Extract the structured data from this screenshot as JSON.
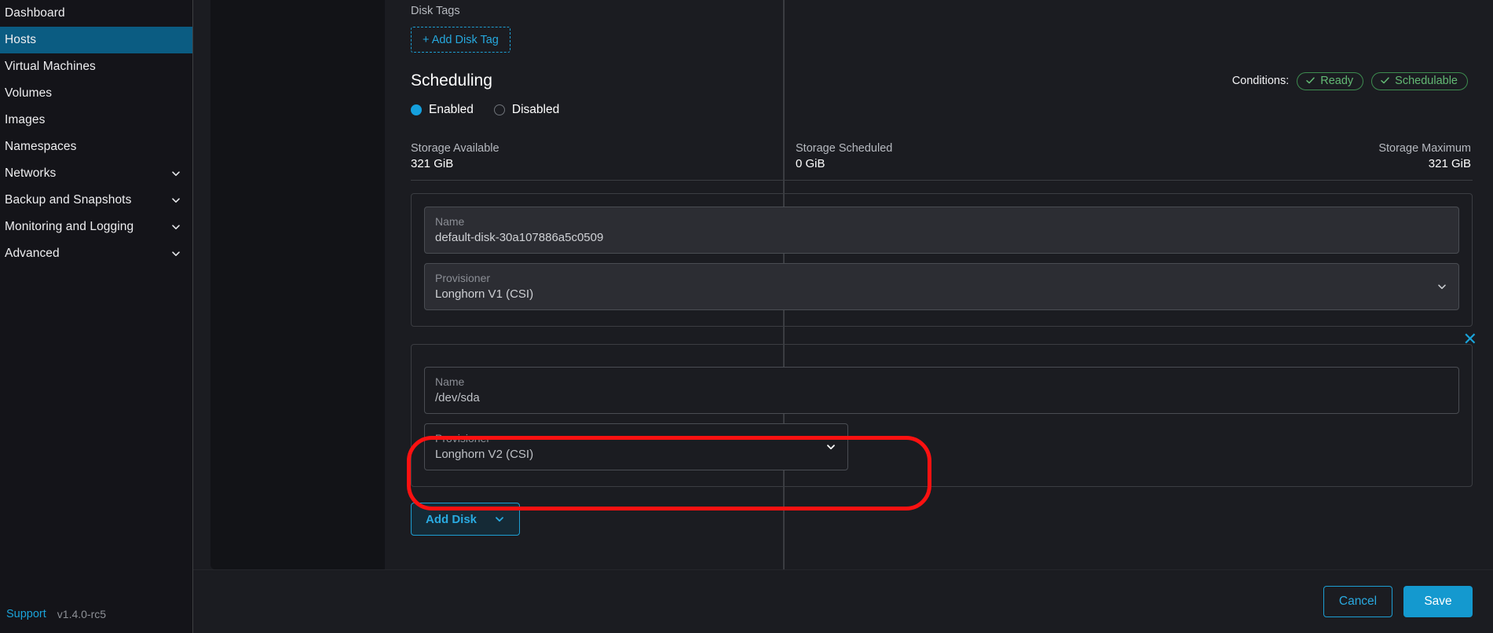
{
  "sidebar": {
    "items": [
      {
        "label": "Dashboard",
        "active": false,
        "expandable": false
      },
      {
        "label": "Hosts",
        "active": true,
        "expandable": false
      },
      {
        "label": "Virtual Machines",
        "active": false,
        "expandable": false
      },
      {
        "label": "Volumes",
        "active": false,
        "expandable": false
      },
      {
        "label": "Images",
        "active": false,
        "expandable": false
      },
      {
        "label": "Namespaces",
        "active": false,
        "expandable": false
      },
      {
        "label": "Networks",
        "active": false,
        "expandable": true
      },
      {
        "label": "Backup and Snapshots",
        "active": false,
        "expandable": true
      },
      {
        "label": "Monitoring and Logging",
        "active": false,
        "expandable": true
      },
      {
        "label": "Advanced",
        "active": false,
        "expandable": true
      }
    ],
    "support_label": "Support",
    "version_label": "v1.4.0-rc5"
  },
  "main": {
    "disk_tags_label": "Disk Tags",
    "add_disk_tag_label": "+ Add Disk Tag",
    "scheduling_title": "Scheduling",
    "conditions_label": "Conditions:",
    "conditions": [
      {
        "label": "Ready",
        "icon": "check-icon"
      },
      {
        "label": "Schedulable",
        "icon": "check-icon"
      }
    ],
    "scheduling_options": [
      {
        "label": "Enabled",
        "selected": true
      },
      {
        "label": "Disabled",
        "selected": false
      }
    ],
    "storage": [
      {
        "key": "Storage Available",
        "value": "321 GiB"
      },
      {
        "key": "Storage Scheduled",
        "value": "0 GiB"
      },
      {
        "key": "Storage Maximum",
        "value": "321 GiB"
      }
    ],
    "disks": [
      {
        "name_label": "Name",
        "name_value": "default-disk-30a107886a5c0509",
        "provisioner_label": "Provisioner",
        "provisioner_value": "Longhorn V1 (CSI)"
      },
      {
        "name_label": "Name",
        "name_value": "/dev/sda",
        "provisioner_label": "Provisioner",
        "provisioner_value": "Longhorn V2 (CSI)",
        "close_label": "✕"
      }
    ],
    "add_disk_label": "Add Disk"
  },
  "footer": {
    "cancel_label": "Cancel",
    "save_label": "Save"
  },
  "colors": {
    "accent": "#1aa3d9",
    "sidebar_active": "#0b5c82",
    "badge_green": "#63b874",
    "highlight_red": "#fc1111",
    "save_blue": "#1499cf"
  }
}
